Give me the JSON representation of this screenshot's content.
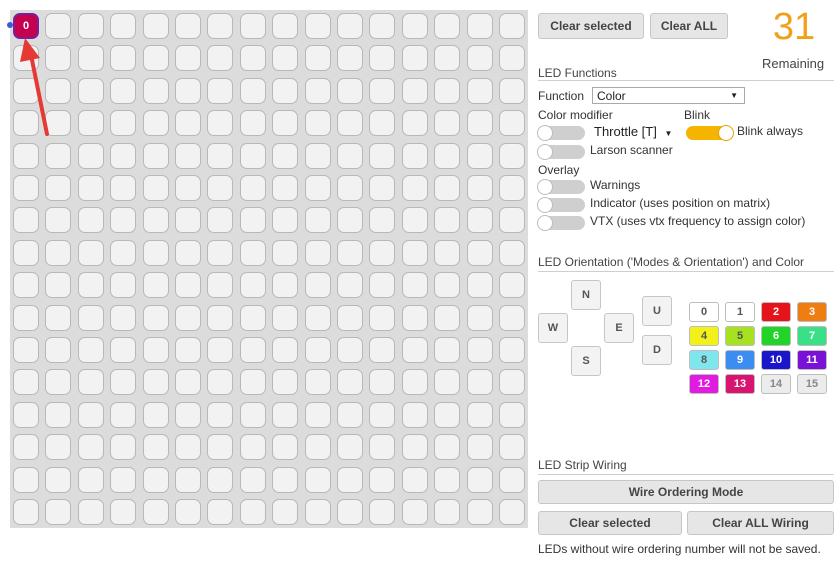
{
  "grid": {
    "rows": 16,
    "cols": 16,
    "selected_led_label": "0"
  },
  "top_buttons": {
    "clear_selected": "Clear selected",
    "clear_all": "Clear ALL"
  },
  "remaining": {
    "count": "31",
    "label": "Remaining"
  },
  "led_functions": {
    "title": "LED Functions",
    "function_label": "Function",
    "function_value": "Color",
    "color_modifier_label": "Color modifier",
    "blink_label": "Blink",
    "throttle_value": "Throttle [T]",
    "blink_always": "Blink always",
    "larson_scanner": "Larson scanner",
    "overlay_label": "Overlay",
    "warnings": "Warnings",
    "indicator": "Indicator (uses position on matrix)",
    "vtx": "VTX (uses vtx frequency to assign color)"
  },
  "orientation": {
    "title": "LED Orientation ('Modes & Orientation') and Color",
    "dirs": {
      "n": "N",
      "w": "W",
      "e": "E",
      "s": "S",
      "u": "U",
      "d": "D"
    },
    "colors": [
      {
        "label": "0",
        "bg": "#ffffff",
        "fg": "#555555"
      },
      {
        "label": "1",
        "bg": "#ffffff",
        "fg": "#555555"
      },
      {
        "label": "2",
        "bg": "#e5141b",
        "fg": "#ffffff"
      },
      {
        "label": "3",
        "bg": "#ee7d12",
        "fg": "#ffffff"
      },
      {
        "label": "4",
        "bg": "#f2f21a",
        "fg": "#555555"
      },
      {
        "label": "5",
        "bg": "#a6e21f",
        "fg": "#555555"
      },
      {
        "label": "6",
        "bg": "#22d32a",
        "fg": "#ffffff"
      },
      {
        "label": "7",
        "bg": "#39e088",
        "fg": "#ffffff"
      },
      {
        "label": "8",
        "bg": "#7fe6ee",
        "fg": "#555555"
      },
      {
        "label": "9",
        "bg": "#3b8df2",
        "fg": "#ffffff"
      },
      {
        "label": "10",
        "bg": "#1b16c9",
        "fg": "#ffffff"
      },
      {
        "label": "11",
        "bg": "#7a11d6",
        "fg": "#ffffff"
      },
      {
        "label": "12",
        "bg": "#e21be0",
        "fg": "#ffffff"
      },
      {
        "label": "13",
        "bg": "#d81370",
        "fg": "#ffffff"
      },
      {
        "label": "14",
        "bg": "#ececec",
        "fg": "#888888"
      },
      {
        "label": "15",
        "bg": "#ececec",
        "fg": "#888888"
      }
    ]
  },
  "wiring": {
    "title": "LED Strip Wiring",
    "wire_ordering_mode": "Wire Ordering Mode",
    "clear_selected": "Clear selected",
    "clear_all_wiring": "Clear ALL Wiring",
    "note": "LEDs without wire ordering number will not be saved."
  },
  "colors": {
    "accent": "#f0a11a",
    "selected_led": "#c4004f",
    "selected_border": "#7a1f9a",
    "arrow": "#e53935"
  }
}
